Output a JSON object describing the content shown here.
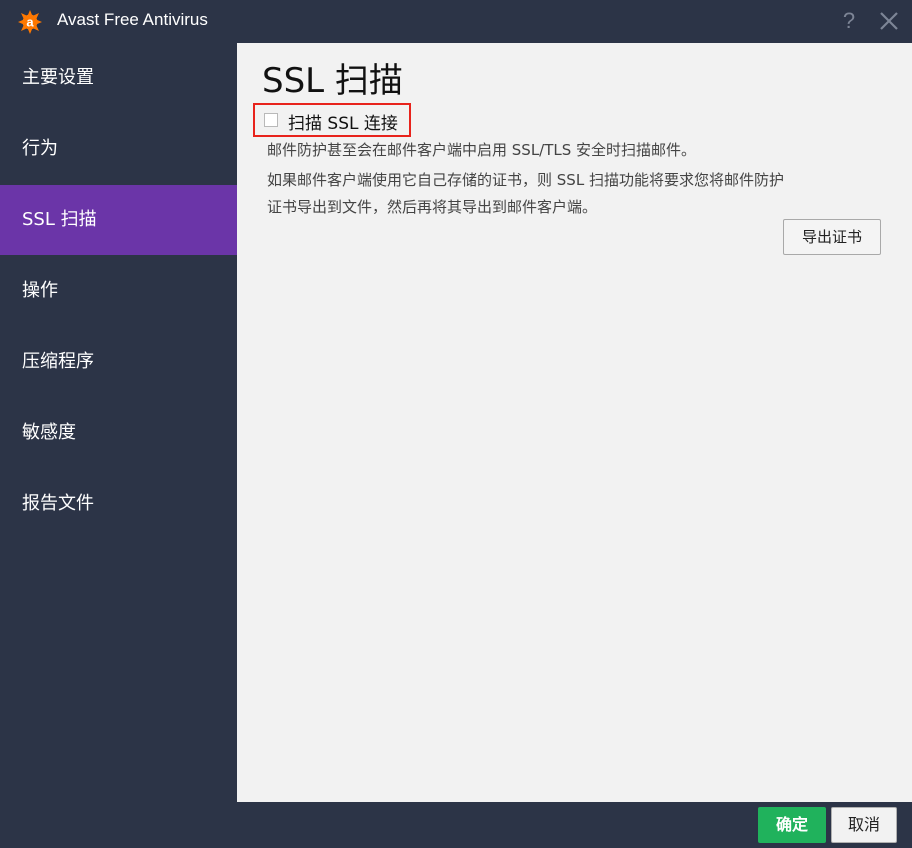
{
  "window": {
    "title": "Avast Free Antivirus",
    "help_glyph": "?",
    "logo_icon": "avast-logo-icon",
    "close_icon": "close-icon"
  },
  "sidebar": {
    "items": [
      {
        "label": "主要设置",
        "active": false
      },
      {
        "label": "行为",
        "active": false
      },
      {
        "label": "SSL 扫描",
        "active": true
      },
      {
        "label": "操作",
        "active": false
      },
      {
        "label": "压缩程序",
        "active": false
      },
      {
        "label": "敏感度",
        "active": false
      },
      {
        "label": "报告文件",
        "active": false
      }
    ]
  },
  "main": {
    "title": "SSL 扫描",
    "scan_checkbox": {
      "label": "扫描 SSL 连接",
      "checked": false
    },
    "description_1": "邮件防护甚至会在邮件客户端中启用 SSL/TLS 安全时扫描邮件。",
    "description_2_line1": "如果邮件客户端使用它自己存储的证书，则 SSL 扫描功能将要求您将邮件防护",
    "description_2_line2": "证书导出到文件，然后再将其导出到邮件客户端。",
    "export_button": "导出证书"
  },
  "footer": {
    "ok_button": "确定",
    "cancel_button": "取消"
  },
  "colors": {
    "window_bg": "#2c3447",
    "active_item": "#6b35a8",
    "content_bg": "#f2f2f2",
    "ok_green": "#20b25c",
    "highlight_red": "#e8231c",
    "brand_orange": "#ff7800"
  }
}
